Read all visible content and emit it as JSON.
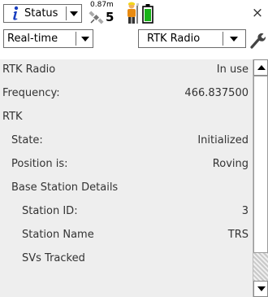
{
  "titlebar": {
    "app_dropdown": {
      "label": "Status"
    },
    "gps": {
      "precision": "0.87m",
      "satellites": "5"
    },
    "close_symbol": "×"
  },
  "toolbar": {
    "mode_dropdown": {
      "value": "Real-time"
    },
    "source_dropdown": {
      "value": "RTK Radio"
    }
  },
  "rows": [
    {
      "label": "RTK Radio",
      "value": "In use"
    },
    {
      "label": "Frequency:",
      "value": "466.837500"
    },
    {
      "label": "RTK",
      "value": ""
    },
    {
      "label": "State:",
      "value": "Initialized"
    },
    {
      "label": "Position is:",
      "value": "Roving"
    },
    {
      "label": "Base Station Details",
      "value": ""
    },
    {
      "label": "Station ID:",
      "value": "3"
    },
    {
      "label": "Station Name",
      "value": "TRS"
    },
    {
      "label": "SVs Tracked",
      "value": ""
    }
  ],
  "scrollbar": {
    "position": 0
  }
}
